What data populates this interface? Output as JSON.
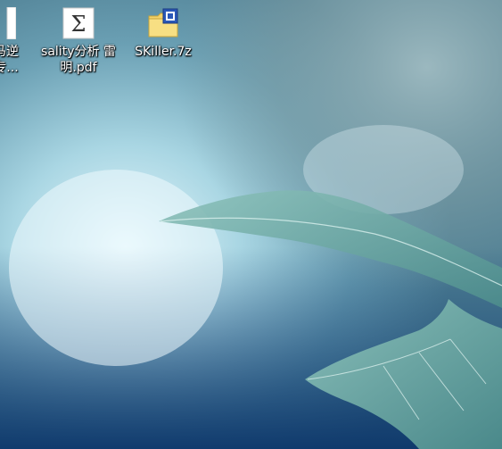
{
  "desktop": {
    "icons": [
      {
        "label": "木马逆\n段专...",
        "icon": "file-icon"
      },
      {
        "label": "sality分析 雷\n明.pdf",
        "icon": "pdf-icon"
      },
      {
        "label": "SKiller.7z",
        "icon": "archive-icon"
      }
    ]
  },
  "colors": {
    "wallpaper_light": "#dff4fb",
    "wallpaper_mid": "#7fb4c4",
    "wallpaper_dark": "#0f3d73",
    "leaf": "#6aa7a2",
    "leaf_edge": "#2f6d70"
  }
}
